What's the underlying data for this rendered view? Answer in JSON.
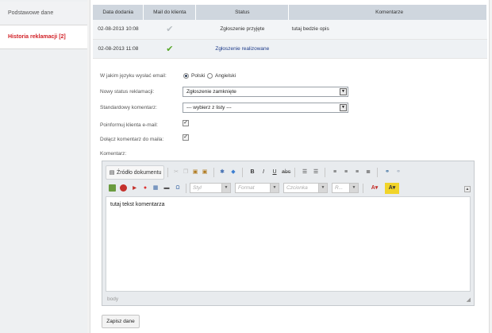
{
  "sidebar": {
    "items": [
      {
        "label": "Podstawowe dane"
      },
      {
        "label": "Historia reklamacji [2]"
      }
    ]
  },
  "history": {
    "columns": [
      "Data dodania",
      "Mail do klienta",
      "Status",
      "Komentarze"
    ],
    "rows": [
      {
        "date": "02-08-2013 10:08",
        "mail_icon": "check-gray",
        "status": "Zgłoszenie przyjęte",
        "comment": "tutaj bedzie opis"
      },
      {
        "date": "02-08-2013 11:08",
        "mail_icon": "check-green",
        "status": "Zgłoszenie realizowane",
        "comment": ""
      }
    ]
  },
  "form": {
    "language_label": "W jakim języku wysłać email:",
    "language_options": [
      "Polski",
      "Angielski"
    ],
    "language_selected": "Polski",
    "new_status_label": "Nowy status reklamacji:",
    "new_status_value": "Zgłoszenie zamknięte",
    "standard_comment_label": "Standardowy komentarz:",
    "standard_comment_value": "--- wybierz z listy ---",
    "notify_label": "Poinformuj klienta e-mail:",
    "notify_checked": true,
    "attach_label": "Dołącz komentarz do maila:",
    "attach_checked": true,
    "comment_label": "Komentarz:"
  },
  "editor": {
    "source_label": "Źródło dokumentu",
    "style_placeholder": "Styl",
    "format_placeholder": "Format",
    "font_placeholder": "Czcionka",
    "size_placeholder": "R...",
    "content": "tutaj tekst komentarza",
    "footer": "body",
    "toolbar_icons": [
      "cut-icon",
      "copy-icon",
      "paste-icon",
      "paste-text-icon",
      "spellcheck-icon",
      "eraser-icon",
      "bold-icon",
      "italic-icon",
      "underline-icon",
      "strike-icon",
      "numbered-list-icon",
      "bullet-list-icon",
      "align-left-icon",
      "align-center-icon",
      "align-right-icon",
      "justify-icon",
      "link-icon",
      "unlink-icon",
      "image-icon",
      "flash-icon",
      "youtube-icon",
      "map-pin-icon",
      "table-icon",
      "hr-icon",
      "special-char-icon",
      "text-color-icon",
      "bg-color-icon"
    ]
  },
  "actions": {
    "save_label": "Zapisz dane"
  },
  "colors": {
    "accent_red": "#d11f25",
    "header_bg": "#cfd6de",
    "status_blue": "#1e3c8a",
    "check_green": "#58a82a"
  }
}
